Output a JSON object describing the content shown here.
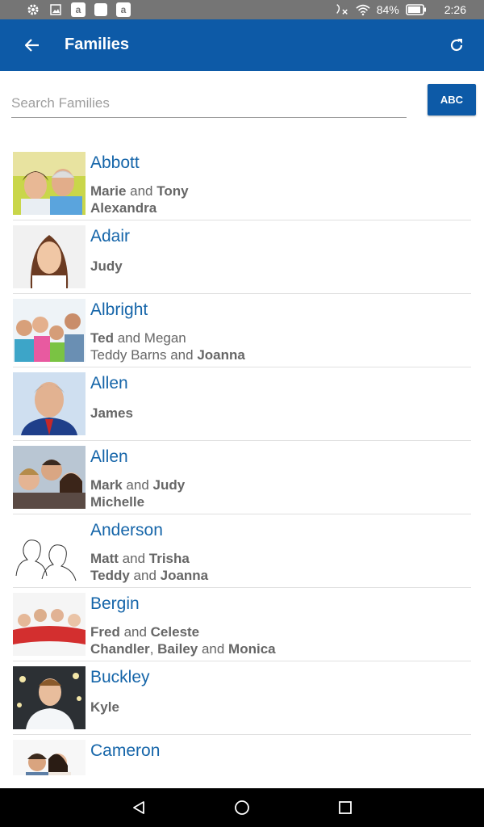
{
  "status_bar": {
    "battery": "84%",
    "time": "2:26",
    "icons": [
      "settings-icon",
      "image-icon",
      "amazon-icon",
      "app-icon",
      "amazon-icon",
      "no-sim-icon",
      "wifi-icon",
      "battery-icon"
    ],
    "amazon_letter": "a"
  },
  "app_bar": {
    "title": "Families",
    "back_icon": "arrow-left-icon",
    "refresh_icon": "refresh-icon",
    "color": "#0d5aa7"
  },
  "search": {
    "placeholder": "Search Families",
    "value": "",
    "abc_label": "ABC"
  },
  "families": [
    {
      "name": "Abbott",
      "lines": [
        [
          [
            "Marie",
            true
          ],
          [
            " and ",
            false
          ],
          [
            "Tony",
            true
          ]
        ],
        [
          [
            "Alexandra",
            true
          ]
        ]
      ]
    },
    {
      "name": "Adair",
      "lines": [
        [
          [
            "Judy",
            true
          ]
        ]
      ]
    },
    {
      "name": "Albright",
      "lines": [
        [
          [
            "Ted",
            true
          ],
          [
            " and Megan",
            false
          ]
        ],
        [
          [
            "Teddy Barns and ",
            false
          ],
          [
            "Joanna",
            true
          ]
        ]
      ]
    },
    {
      "name": "Allen",
      "lines": [
        [
          [
            "James",
            true
          ]
        ]
      ]
    },
    {
      "name": "Allen",
      "lines": [
        [
          [
            "Mark",
            true
          ],
          [
            " and ",
            false
          ],
          [
            "Judy",
            true
          ]
        ],
        [
          [
            "Michelle",
            true
          ]
        ]
      ]
    },
    {
      "name": "Anderson",
      "lines": [
        [
          [
            "Matt",
            true
          ],
          [
            " and ",
            false
          ],
          [
            "Trisha",
            true
          ]
        ],
        [
          [
            "Teddy",
            true
          ],
          [
            " and ",
            false
          ],
          [
            "Joanna",
            true
          ]
        ]
      ]
    },
    {
      "name": "Bergin",
      "lines": [
        [
          [
            "Fred",
            true
          ],
          [
            " and ",
            false
          ],
          [
            "Celeste",
            true
          ]
        ],
        [
          [
            "Chandler",
            true
          ],
          [
            ", ",
            false
          ],
          [
            "Bailey",
            true
          ],
          [
            " and ",
            false
          ],
          [
            "Monica",
            true
          ]
        ]
      ]
    },
    {
      "name": "Buckley",
      "lines": [
        [
          [
            "Kyle",
            true
          ]
        ]
      ]
    },
    {
      "name": "Cameron",
      "lines": []
    }
  ],
  "nav_bar": {
    "icons": [
      "back-triangle-icon",
      "home-circle-icon",
      "recents-square-icon"
    ]
  }
}
